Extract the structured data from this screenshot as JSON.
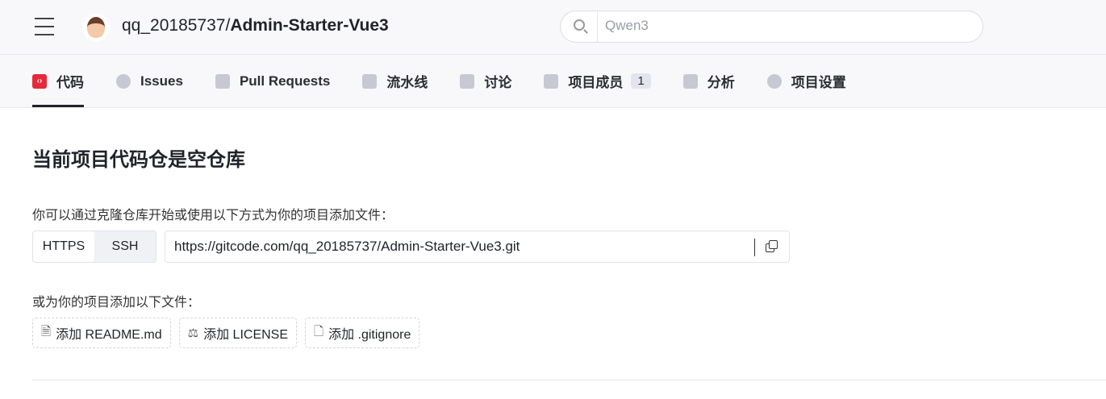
{
  "header": {
    "owner": "qq_20185737/",
    "repo": "Admin-Starter-Vue3",
    "search_placeholder": "Qwen3"
  },
  "tabs": [
    {
      "label": "代码",
      "icon": "code-icon",
      "active": true
    },
    {
      "label": "Issues",
      "icon": "issue-icon"
    },
    {
      "label": "Pull Requests",
      "icon": "pull-request-icon"
    },
    {
      "label": "流水线",
      "icon": "pipeline-icon"
    },
    {
      "label": "讨论",
      "icon": "discussion-icon"
    },
    {
      "label": "项目成员",
      "icon": "members-icon",
      "badge": "1"
    },
    {
      "label": "分析",
      "icon": "analytics-icon"
    },
    {
      "label": "项目设置",
      "icon": "settings-icon"
    }
  ],
  "main": {
    "title": "当前项目代码仓是空仓库",
    "clone_label": "你可以通过克隆仓库开始或使用以下方式为你的项目添加文件：",
    "protocols": [
      "HTTPS",
      "SSH"
    ],
    "clone_url": "https://gitcode.com/qq_20185737/Admin-Starter-Vue3.git",
    "add_label": "或为你的项目添加以下文件：",
    "add_buttons": [
      "添加 README.md",
      "添加 LICENSE",
      "添加 .gitignore"
    ]
  }
}
